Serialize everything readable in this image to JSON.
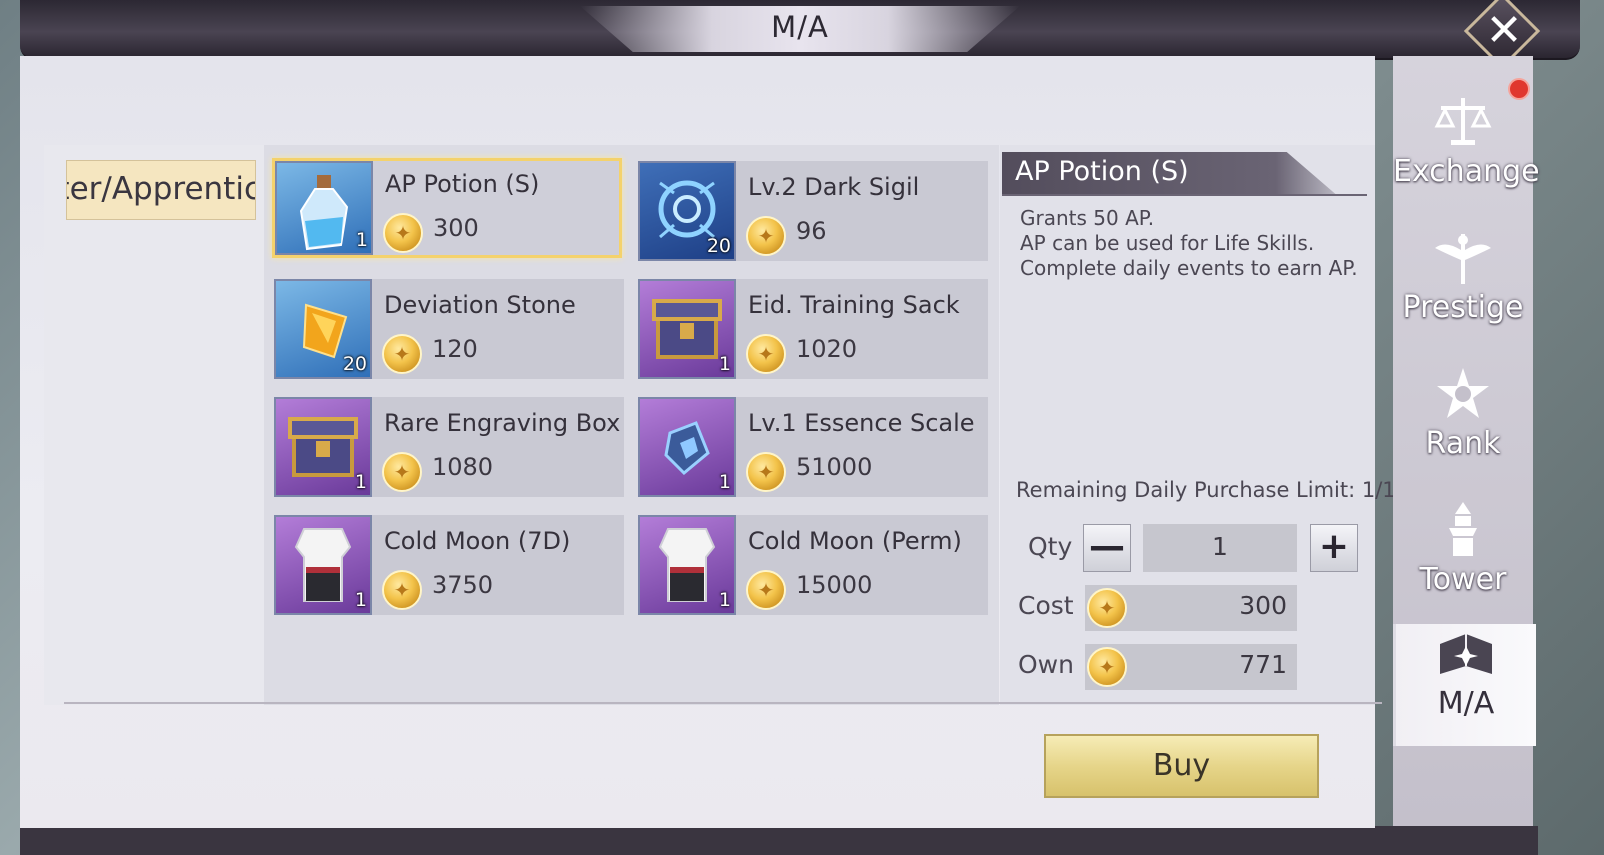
{
  "window": {
    "title": "M/A"
  },
  "category": {
    "active_label": "aster/Apprentic"
  },
  "items": [
    {
      "name": "AP Potion (S)",
      "price": "300",
      "qty": "1",
      "icon": "potion-icon",
      "selected": true
    },
    {
      "name": "Lv.2 Dark Sigil",
      "price": "96",
      "qty": "20",
      "icon": "sigil-icon"
    },
    {
      "name": "Deviation Stone",
      "price": "120",
      "qty": "20",
      "icon": "gem-icon"
    },
    {
      "name": "Eid. Training Sack",
      "price": "1020",
      "qty": "1",
      "icon": "chest-icon"
    },
    {
      "name": "Rare Engraving Box",
      "price": "1080",
      "qty": "1",
      "icon": "chest-icon"
    },
    {
      "name": "Lv.1 Essence Scale",
      "price": "51000",
      "qty": "1",
      "icon": "scale-crystal-icon"
    },
    {
      "name": "Cold Moon (7D)",
      "price": "3750",
      "qty": "1",
      "icon": "robe-icon"
    },
    {
      "name": "Cold Moon (Perm)",
      "price": "15000",
      "qty": "1",
      "icon": "robe-icon"
    }
  ],
  "detail": {
    "title": "AP Potion (S)",
    "lines": [
      "Grants 50 AP.",
      "AP can be used for Life Skills.",
      "Complete daily events to earn AP."
    ],
    "limit": "Remaining Daily Purchase Limit: 1/1",
    "qty_label": "Qty",
    "qty_value": "1",
    "cost_label": "Cost",
    "cost_value": "300",
    "own_label": "Own",
    "own_value": "771",
    "minus": "—",
    "plus": "+"
  },
  "buy_label": "Buy",
  "sidebar": [
    {
      "label": "Exchange",
      "icon": "scales-icon"
    },
    {
      "label": "Prestige",
      "icon": "winged-emblem-icon"
    },
    {
      "label": "Rank",
      "icon": "star-emblem-icon"
    },
    {
      "label": "Tower",
      "icon": "tower-icon"
    },
    {
      "label": "M/A",
      "icon": "book-icon",
      "active": true
    }
  ],
  "colors": {
    "selected_border": "#f4d26c",
    "coin": "#f3c34a",
    "buy_button": "#e6d58a",
    "notification": "#e0372e"
  }
}
